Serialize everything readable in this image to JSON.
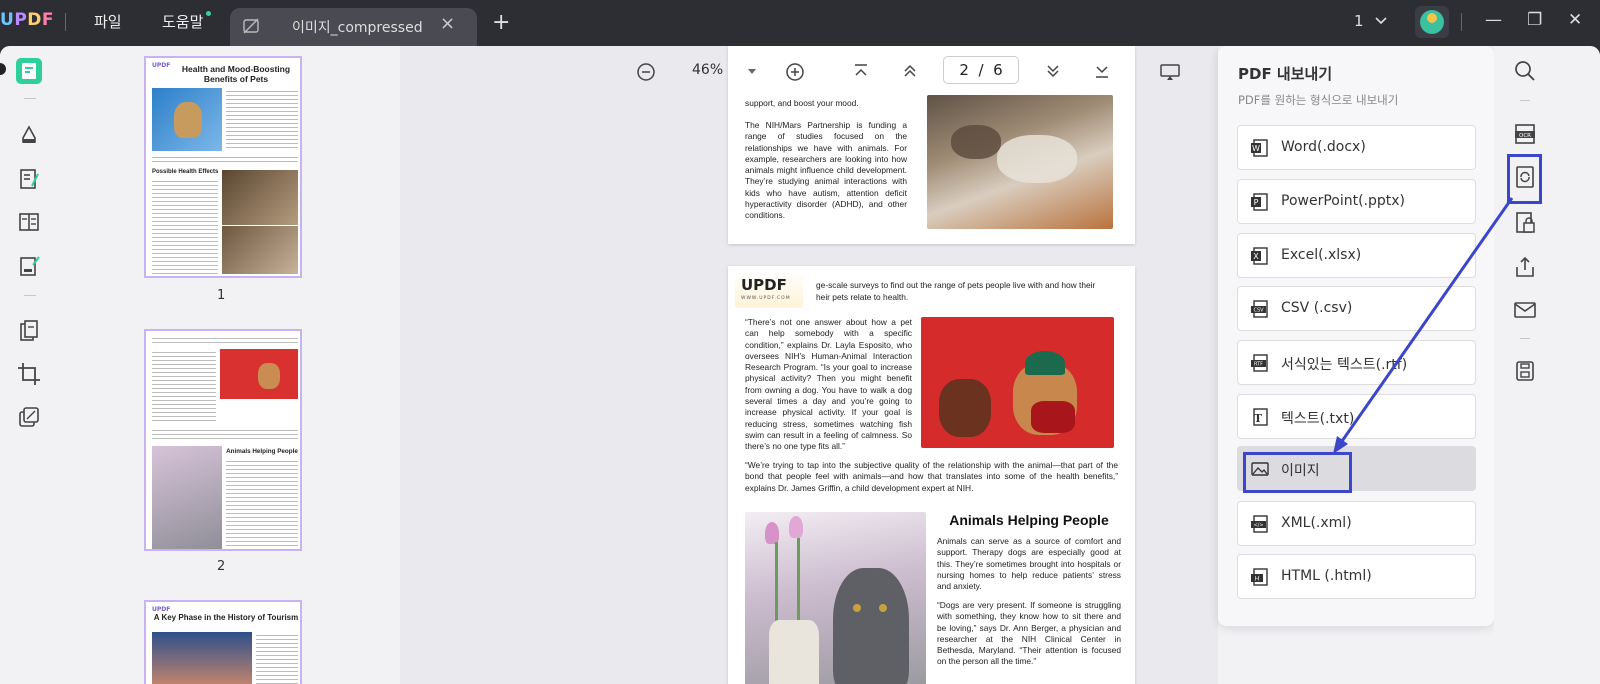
{
  "app": {
    "logo": "UPDF"
  },
  "menu": {
    "file": "파일",
    "help": "도움말"
  },
  "tab": {
    "title": "이미지_compressed",
    "close": "×",
    "add": "+"
  },
  "window": {
    "page_indicator": "1",
    "minimize": "—",
    "restore": "❐",
    "close": "✕"
  },
  "toolbar": {
    "zoom": "46%",
    "page_current": "2",
    "page_sep": "/",
    "page_total": "6"
  },
  "thumbnails": [
    {
      "label": "1",
      "title": "Health and Mood-Boosting Benefits of Pets",
      "heading2": "Possible Health Effects"
    },
    {
      "label": "2",
      "heading": "Animals Helping People"
    },
    {
      "label": "",
      "title": "A Key Phase in the History of Tourism"
    }
  ],
  "page1": {
    "top_line": "support, and boost your mood.",
    "para": "The NIH/Mars Partnership is funding a range of studies focused on the relationships we have with animals. For example, researchers are looking into how animals might influence child development. They’re studying animal interactions with kids who have autism, attention deficit hyperactivity disorder (ADHD), and other conditions."
  },
  "page2": {
    "stamp_logo": "UPDF",
    "stamp_url": "WWW.UPDF.COM",
    "intro_line1": "ge-scale surveys to find out the range of pets people live with and how their",
    "intro_line2": "heir pets relate to health.",
    "quote1": "“There’s not one answer about how a pet can help somebody with a specific condition,” explains Dr. Layla Esposito, who oversees NIH’s Human-Animal Interaction Research Program. “Is your goal to increase physical activity? Then you might benefit from owning a dog. You have to walk a dog several times a day and you’re going to increase physical activity. If your goal is reducing stress, sometimes watching fish swim can result in a feeling of calmness. So there’s no one type fits all.”",
    "quote2": "“We’re trying to tap into the subjective quality of the relationship with the animal—that part of the bond that people feel with animals—and how that translates into some of the health benefits,” explains Dr. James Griffin, a child development expert at NIH.",
    "heading": "Animals Helping People",
    "para1": "Animals can serve as a source of comfort and support. Therapy dogs are especially good at this. They’re sometimes brought into hospitals or nursing homes to help reduce patients’ stress and anxiety.",
    "para2": "“Dogs are very present. If someone is struggling with something, they know how to sit there and be loving,” says Dr. Ann Berger, a physician and researcher at the NIH Clinical Center in Bethesda, Maryland. “Their attention is focused on the person all the time.”"
  },
  "export": {
    "title": "PDF 내보내기",
    "subtitle": "PDF를 원하는 형식으로 내보내기",
    "items": [
      {
        "label": "Word(.docx)",
        "icon": "word-icon",
        "color": "#2b579a"
      },
      {
        "label": "PowerPoint(.pptx)",
        "icon": "powerpoint-icon",
        "color": "#333333"
      },
      {
        "label": "Excel(.xlsx)",
        "icon": "excel-icon",
        "color": "#333333"
      },
      {
        "label": "CSV (.csv)",
        "icon": "csv-icon",
        "color": "#333333"
      },
      {
        "label": "서식있는 텍스트(.rtf)",
        "icon": "rtf-icon",
        "color": "#333333"
      },
      {
        "label": "텍스트(.txt)",
        "icon": "txt-icon",
        "color": "#333333"
      },
      {
        "label": "이미지",
        "icon": "image-icon",
        "color": "#333333",
        "selected": true
      },
      {
        "label": "XML(.xml)",
        "icon": "xml-icon",
        "color": "#333333"
      },
      {
        "label": "HTML (.html)",
        "icon": "html-icon",
        "color": "#333333"
      }
    ]
  },
  "colors": {
    "accent": "#2ecf9b",
    "highlight": "#3b46c9",
    "thumb_border": "#c8b3f0"
  }
}
